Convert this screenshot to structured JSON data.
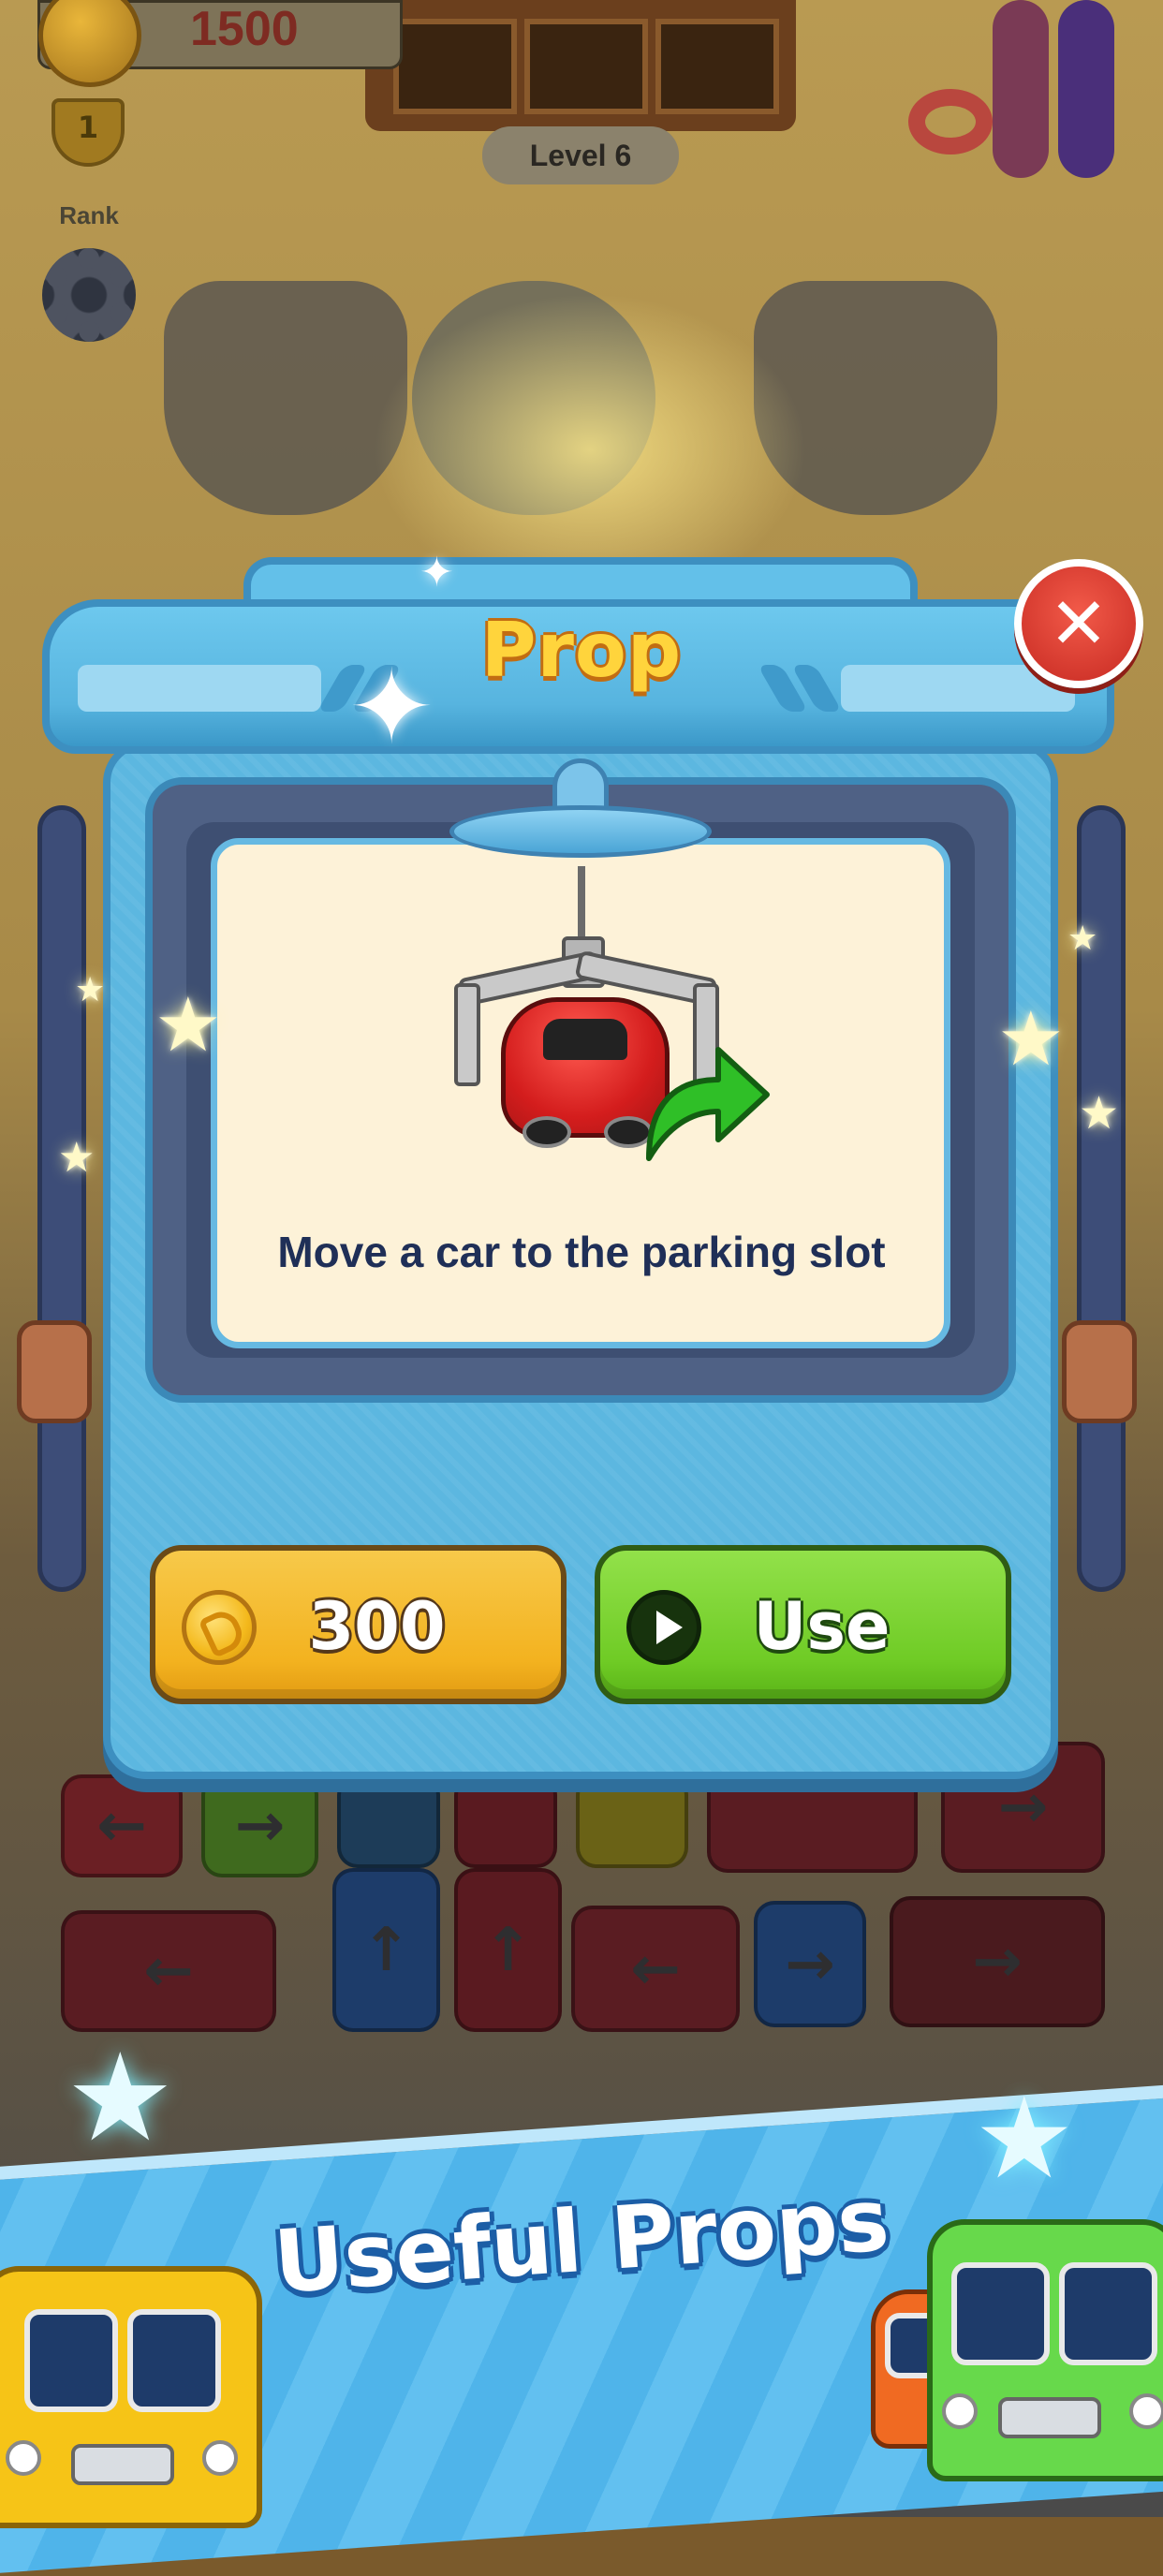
{
  "hud": {
    "coins": "1500",
    "level": "Level 6",
    "rank_label": "Rank",
    "rank_value": "1"
  },
  "popup": {
    "title": "Prop",
    "description": "Move a car to the parking slot",
    "price": "300",
    "use_label": "Use"
  },
  "banner": {
    "text": "Useful Props"
  },
  "colors": {
    "popup_bg": "#5cb7e0",
    "title": "#ffd43c",
    "coin_button": "#f3b21f",
    "use_button": "#6fcb25",
    "close_button": "#e23a2e",
    "description": "#1f2f57"
  },
  "icons": [
    "coin-icon",
    "trophy-icon",
    "gear-icon",
    "close-icon",
    "play-icon",
    "claw-car-icon",
    "green-arrow-icon",
    "star-icon"
  ]
}
